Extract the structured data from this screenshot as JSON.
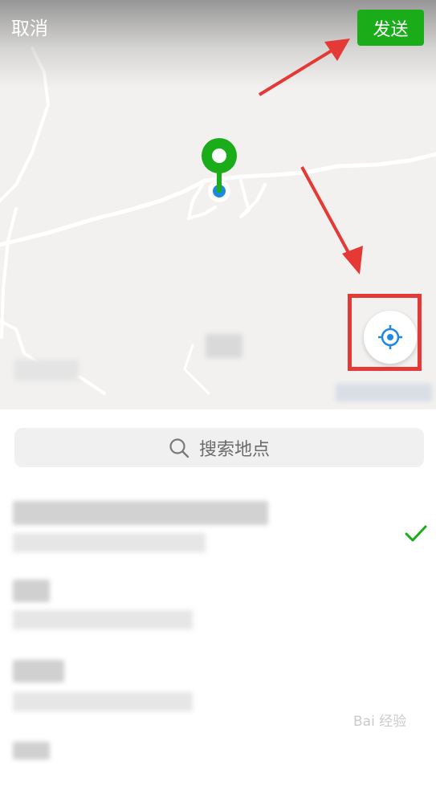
{
  "header": {
    "cancel_label": "取消",
    "send_label": "发送"
  },
  "search": {
    "placeholder": "搜索地点"
  },
  "colors": {
    "send_button": "#1aad19",
    "pin": "#1aad19",
    "location_dot": "#1e88e5",
    "annotation": "#e53935",
    "check": "#1aad19"
  },
  "icons": {
    "pin": "map-pin-icon",
    "locate": "crosshair-locate-icon",
    "search": "search-icon",
    "selected": "checkmark-icon"
  },
  "watermark": "Bai 经验"
}
